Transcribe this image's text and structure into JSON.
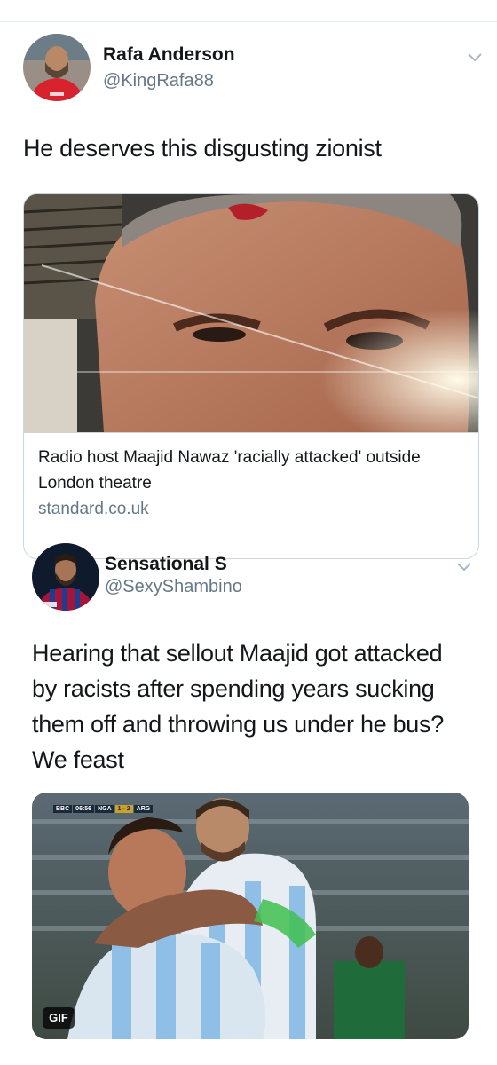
{
  "tweets": [
    {
      "name": "Rafa Anderson",
      "handle": "@KingRafa88",
      "text": "He deserves this disgusting zionist",
      "card": {
        "title": "Radio host Maajid Nawaz 'racially attacked' outside London theatre",
        "domain": "standard.co.uk"
      }
    },
    {
      "name": "Sensational S",
      "handle": "@SexyShambino",
      "text_lines": [
        "Hearing that sellout Maajid got attacked",
        "by racists after spending years sucking",
        "them off and throwing us under he bus?",
        "We feast"
      ],
      "media": {
        "badge": "GIF",
        "scoreboard": [
          "BBC",
          "06:56",
          "NGA",
          "1 - 2",
          "ARG"
        ]
      }
    }
  ],
  "colors": {
    "text": "#14171a",
    "secondary": "#657786",
    "border": "#ccd6dd"
  }
}
